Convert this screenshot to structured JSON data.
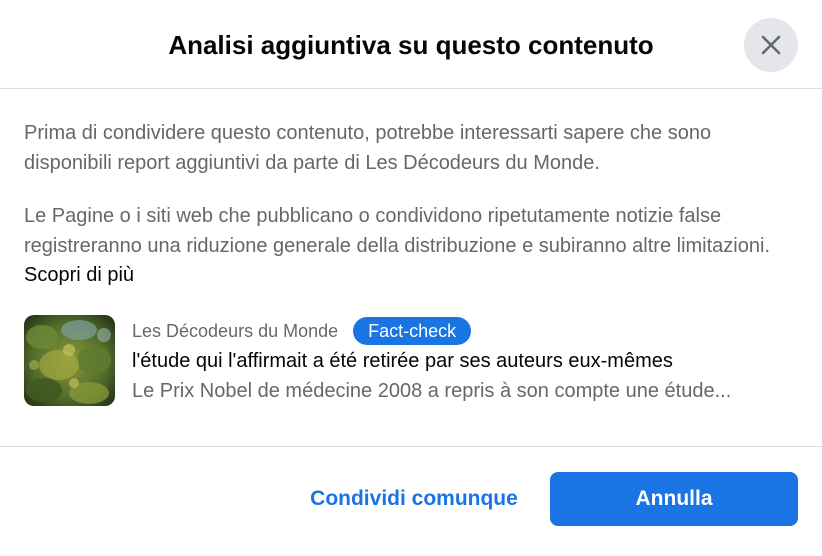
{
  "dialog": {
    "title": "Analisi aggiuntiva su questo contenuto",
    "close_icon": "close-icon"
  },
  "body": {
    "paragraph1": "Prima di condividere questo contenuto, potrebbe interessarti sapere che sono disponibili report aggiuntivi da parte di Les Décodeurs du Monde.",
    "paragraph2": "Le Pagine o i siti web che pubblicano o condividono ripetutamente notizie false registreranno una riduzione generale della distribuzione e subiranno altre limitazioni.",
    "learn_more": "Scopri di più"
  },
  "article": {
    "source": "Les Décodeurs du Monde",
    "badge": "Fact-check",
    "headline": "l'étude qui l'affirmait a été retirée par ses auteurs eux-mêmes",
    "snippet": "Le Prix Nobel de médecine 2008 a repris à son compte une étude..."
  },
  "footer": {
    "share_anyway": "Condividi comunque",
    "cancel": "Annulla"
  },
  "colors": {
    "accent": "#1b74e4",
    "secondary_text": "#65676b",
    "primary_text": "#050505",
    "close_bg": "#e4e6eb",
    "divider": "#dadde1"
  }
}
